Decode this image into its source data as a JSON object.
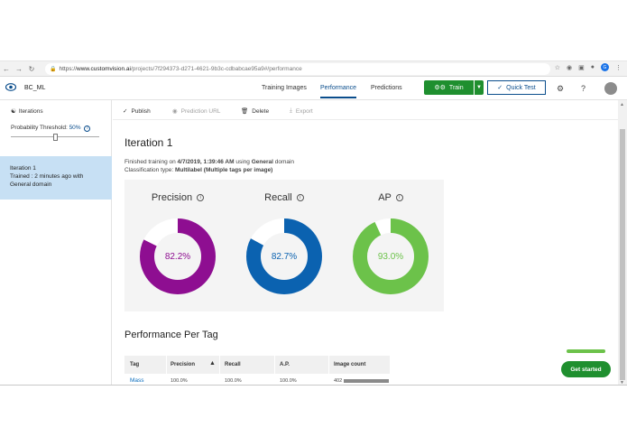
{
  "browser": {
    "url_prefix": "https://",
    "url_host": "www.customvision.ai",
    "url_path": "/projects/7f294373-d271-4621-9b3c-cdbabcae95a9#/performance",
    "profile_initial": "G"
  },
  "header": {
    "project_name": "BC_ML",
    "tabs": [
      {
        "label": "Training Images"
      },
      {
        "label": "Performance"
      },
      {
        "label": "Predictions"
      }
    ],
    "train_label": "Train",
    "quick_test_label": "Quick Test"
  },
  "sidebar": {
    "iterations_label": "Iterations",
    "threshold_label": "Probability Threshold:",
    "threshold_value": "50%",
    "threshold_level": 0.5,
    "iteration_item": {
      "title": "Iteration 1",
      "subtitle": "Trained : 2 minutes ago with General domain"
    }
  },
  "toolbar": {
    "publish": "Publish",
    "prediction_url": "Prediction URL",
    "delete": "Delete",
    "export": "Export"
  },
  "main": {
    "iteration_title": "Iteration 1",
    "finished_prefix": "Finished training on ",
    "finished_date": "4/7/2019, 1:39:46 AM",
    "finished_mid": " using ",
    "finished_domain": "General",
    "finished_suffix": " domain",
    "classification_prefix": "Classification type: ",
    "classification_type": "Multilabel (Multiple tags per image)",
    "metrics": [
      {
        "label": "Precision",
        "value": "82.2%",
        "fraction": 0.822,
        "color": "#8e0e91"
      },
      {
        "label": "Recall",
        "value": "82.7%",
        "fraction": 0.827,
        "color": "#0b62b0"
      },
      {
        "label": "AP",
        "value": "93.0%",
        "fraction": 0.93,
        "color": "#6cc24a"
      }
    ],
    "per_tag_title": "Performance Per Tag",
    "table": {
      "headers": [
        "Tag",
        "Precision",
        "Recall",
        "A.P.",
        "Image count"
      ],
      "rows": [
        {
          "tag": "Mass",
          "precision": "100.0%",
          "recall": "100.0%",
          "ap": "100.0%",
          "count": "402"
        }
      ]
    }
  },
  "get_started": {
    "label": "Get started"
  }
}
